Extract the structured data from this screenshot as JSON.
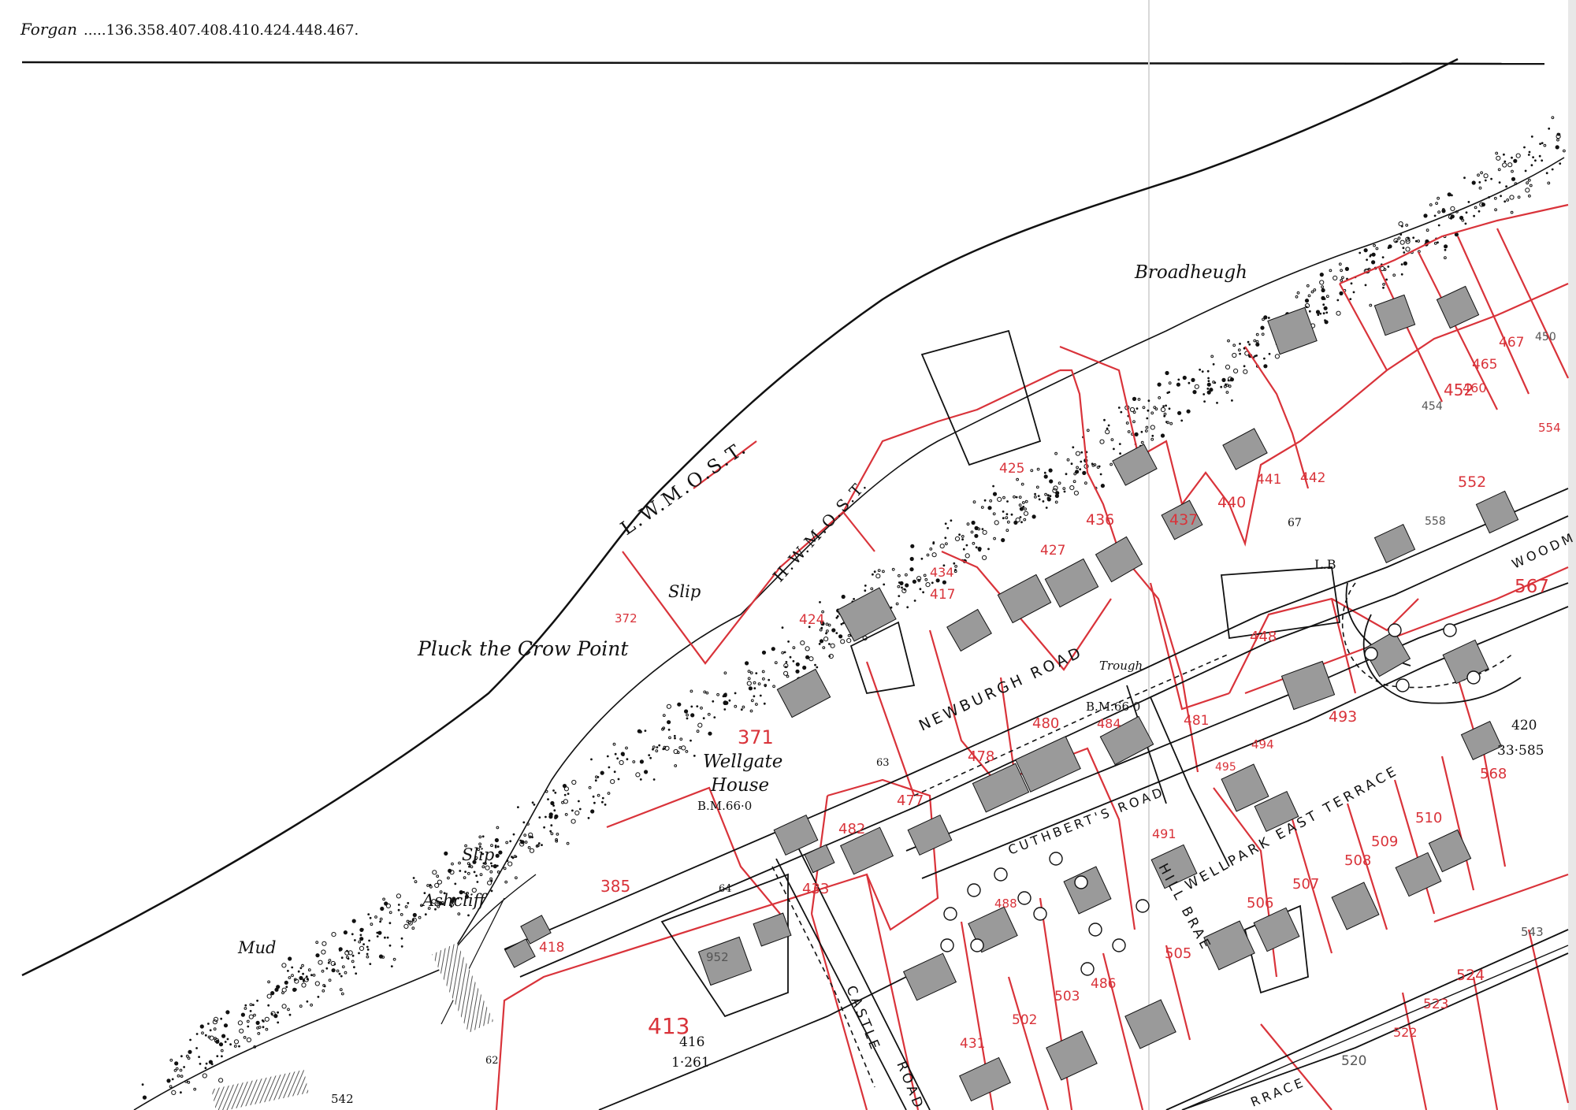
{
  "sheet": {
    "index_label": "Forgan",
    "index_numbers": ".....136.358.407.408.410.424.448.467."
  },
  "places": {
    "pluck": "Pluck the Crow Point",
    "broadheugh": "Broadheugh",
    "wellgate": "Wellgate",
    "house": "House",
    "mud": "Mud",
    "ashcliff": "Ashcliff",
    "slip_west": "Slip",
    "slip_north": "Slip",
    "lwmost": "L.W.M.O.S.T.",
    "hwmost": "H.W.M.O.S.T.",
    "trough": "Trough",
    "lb": "L.B"
  },
  "roads": {
    "newburgh": "NEWBURGH ROAD",
    "cuthberts": "CUTHBERT'S ROAD",
    "wellpark": "WELLPARK EAST TERRACE",
    "hillbrae": "HILL BRAE",
    "castle": "CASTLE",
    "castle_road": "ROAD",
    "woodm": "WOODM",
    "terrace_fragment": "RRACE"
  },
  "benchmarks": {
    "wellgate_bm": "B.M.66·0",
    "newburgh_bm": "B.M.66·0"
  },
  "survey_numbers": {
    "n420": "420",
    "a420": "33·585",
    "n416": "416",
    "a416": "1·261",
    "s63": "63",
    "s64": "64",
    "s62": "62",
    "s67": "67",
    "s542": "542"
  },
  "parcels": {
    "p371": "371",
    "p372": "372",
    "p385": "385",
    "p413": "413",
    "p417": "417",
    "p418": "418",
    "p424": "424",
    "p425": "425",
    "p427": "427",
    "p431": "431",
    "p433": "433",
    "p434": "434",
    "p436": "436",
    "p437": "437",
    "p440": "440",
    "p441": "441",
    "p442": "442",
    "p448": "448",
    "p450": "450",
    "p452": "452",
    "p454": "454",
    "p460": "460",
    "p465": "465",
    "p467": "467",
    "p477": "477",
    "p478": "478",
    "p480": "480",
    "p481": "481",
    "p482": "482",
    "p484": "484",
    "p486": "486",
    "p488": "488",
    "p491": "491",
    "p493": "493",
    "p494": "494",
    "p495": "495",
    "p502": "502",
    "p503": "503",
    "p505": "505",
    "p506": "506",
    "p507": "507",
    "p508": "508",
    "p509": "509",
    "p510": "510",
    "p520": "520",
    "p522": "522",
    "p523": "523",
    "p524": "524",
    "p543": "543",
    "p552": "552",
    "p554": "554",
    "p558": "558",
    "p567": "567",
    "p568": "568",
    "p952": "952"
  },
  "colors": {
    "ink": "#1a1a1a",
    "parcel_red": "#d9333a",
    "paper": "#ffffff",
    "building": "#9a9a9a"
  }
}
